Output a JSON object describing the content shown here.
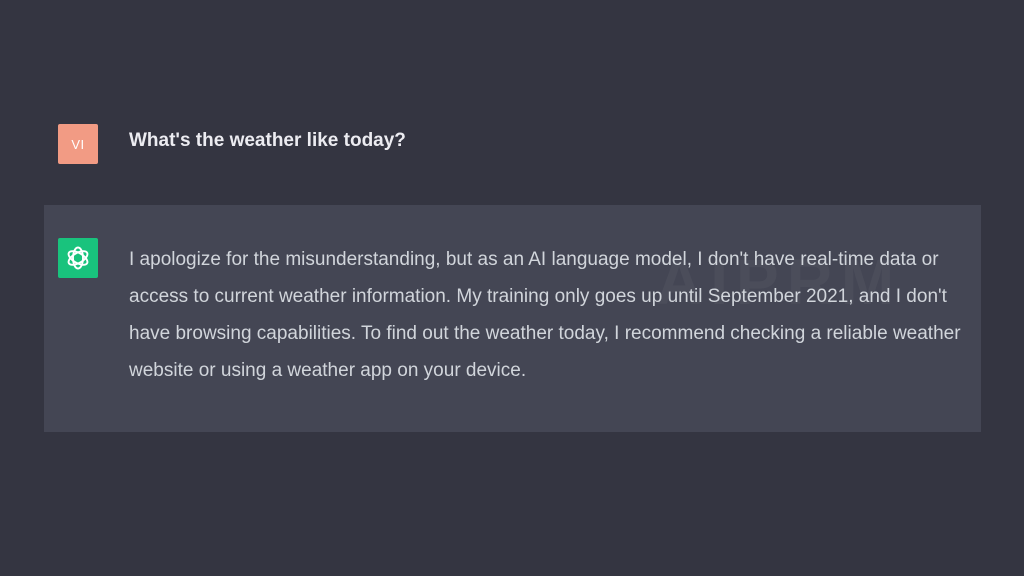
{
  "colors": {
    "page_background": "#343541",
    "assistant_background": "#444654",
    "user_avatar": "#f29b84",
    "assistant_avatar": "#19c37d"
  },
  "user_message": {
    "avatar_initials": "VI",
    "text": "What's the weather like today?"
  },
  "assistant_message": {
    "avatar_icon": "openai-logo-icon",
    "text": "I apologize for the misunderstanding, but as an AI language model, I don't have real-time data or access to current weather information. My training only goes up until September 2021, and I don't have browsing capabilities. To find out the weather today, I recommend checking a reliable weather website or using a weather app on your device."
  },
  "watermark": "AIPRM"
}
